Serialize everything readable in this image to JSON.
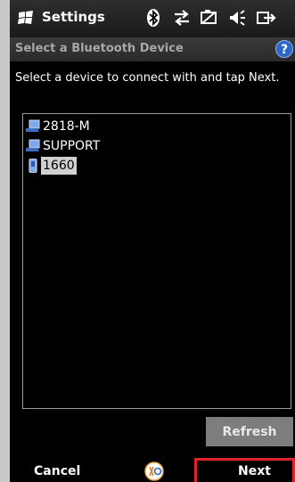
{
  "titlebar": {
    "title": "Settings",
    "icons": [
      "windows-flag-icon",
      "bluetooth-icon",
      "sync-arrows-icon",
      "battery-icon",
      "speaker-icon",
      "exit-icon"
    ]
  },
  "header": {
    "subtitle": "Select a Bluetooth Device",
    "help": "?"
  },
  "instruction": "Select a device to connect with and tap Next.",
  "devices": [
    {
      "label": "2818-M",
      "icon": "computer-icon",
      "selected": false
    },
    {
      "label": "SUPPORT",
      "icon": "computer-icon",
      "selected": false
    },
    {
      "label": "1660",
      "icon": "mobile-device-icon",
      "selected": true
    }
  ],
  "buttons": {
    "refresh": "Refresh"
  },
  "softkeys": {
    "left": "Cancel",
    "right": "Next"
  },
  "colors": {
    "highlight": "#e0232a",
    "selection": "#d0d0d0",
    "help": "#2f67c7"
  }
}
